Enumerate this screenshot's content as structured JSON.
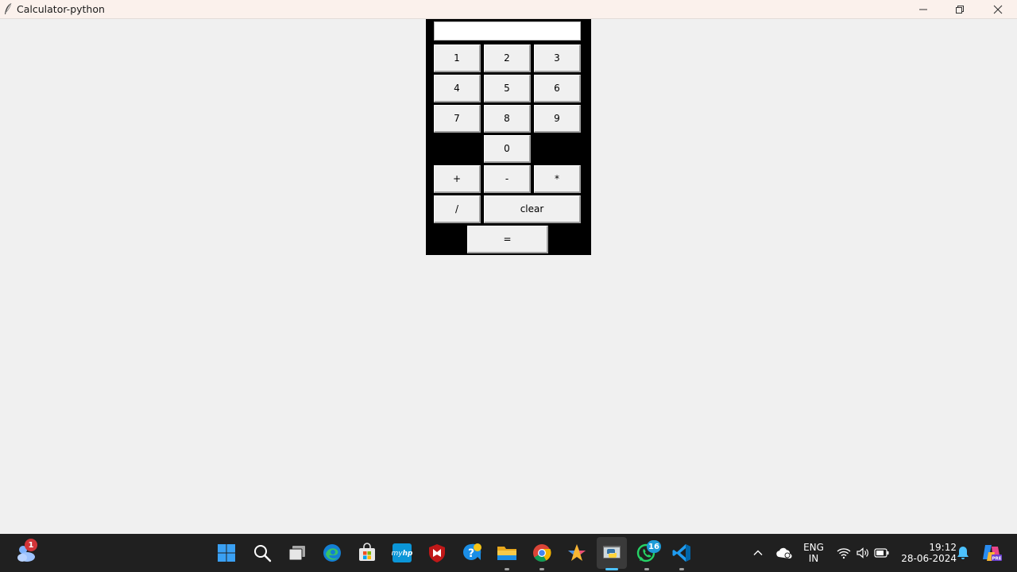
{
  "window": {
    "title": "Calculator-python"
  },
  "calculator": {
    "display_value": "",
    "buttons": {
      "one": "1",
      "two": "2",
      "three": "3",
      "four": "4",
      "five": "5",
      "six": "6",
      "seven": "7",
      "eight": "8",
      "nine": "9",
      "zero": "0",
      "plus": "+",
      "minus": "-",
      "multiply": "*",
      "divide": "/",
      "clear": "clear",
      "equals": "="
    }
  },
  "taskbar": {
    "weather_badge": "1",
    "whatsapp_badge": "16",
    "icons": [
      "weather-widget-icon",
      "start-icon",
      "search-icon",
      "task-view-icon",
      "edge-icon",
      "store-icon",
      "myhp-icon",
      "mcafee-icon",
      "help-icon",
      "file-explorer-icon",
      "chrome-icon",
      "star-app-icon",
      "python-icon",
      "whatsapp-icon",
      "vscode-icon"
    ]
  },
  "tray": {
    "language_line1": "ENG",
    "language_line2": "IN",
    "time": "19:12",
    "date": "28-06-2024"
  },
  "colors": {
    "taskbar_bg": "#202020",
    "calc_bg": "#000000",
    "button_face": "#f0f0f0",
    "accent": "#4cc2ff"
  }
}
